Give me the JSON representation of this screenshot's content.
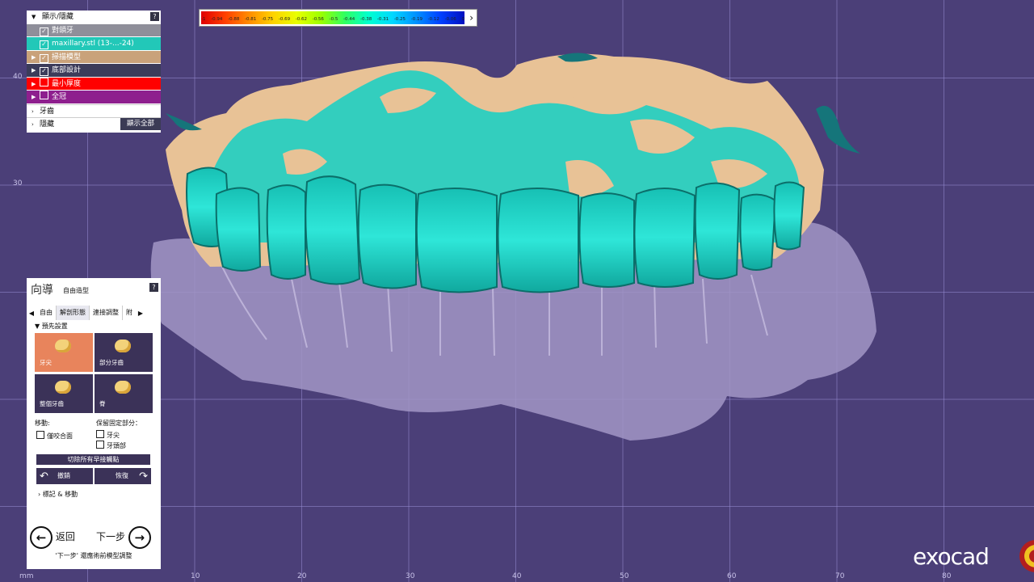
{
  "color_scale": {
    "ticks": [
      "-1",
      "-0.94",
      "-0.88",
      "-0.81",
      "-0.75",
      "-0.69",
      "-0.62",
      "-0.56",
      "-0.5",
      "-0.44",
      "-0.38",
      "-0.31",
      "-0.25",
      "-0.19",
      "-0.12",
      "-0.06",
      "0"
    ],
    "arrow": "›"
  },
  "display_panel": {
    "header": "顯示/隱藏",
    "help": "?",
    "rows": [
      {
        "label": "對頜牙",
        "checked": "✓",
        "color": "#8f8f9a"
      },
      {
        "label": "maxillary.stl (13-...-24)",
        "checked": "✓",
        "color": "#22c8b8"
      },
      {
        "label": "掃描模型",
        "checked": "✓",
        "color": "#c9a27a"
      },
      {
        "label": "底部設計",
        "checked": "✓",
        "color": "#3c3c5a"
      },
      {
        "label": "最小厚度",
        "checked": "",
        "color": "#ff0000"
      },
      {
        "label": "全冠",
        "checked": "",
        "color": "#8e1f8e"
      }
    ],
    "teeth_label": "牙齒",
    "hidden_label": "隱藏",
    "show_all": "顯示全部"
  },
  "wizard": {
    "title": "向導",
    "subtitle": "自由造型",
    "help": "?",
    "tabs": [
      "自由",
      "解剖形態",
      "連接調整",
      "附"
    ],
    "preset_header": "預先設置",
    "tools": [
      "牙尖",
      "部分牙齒",
      "整個牙齒",
      "脊"
    ],
    "move_label": "移動:",
    "keep_label": "保留固定部分：",
    "occlusal_only": "僅咬合面",
    "keep_cusp": "牙尖",
    "keep_crown": "牙頭部",
    "remove_contacts": "切除所有早接觸點",
    "undo": "撤銷",
    "redo": "恢復",
    "mark_move": "標記 & 移動",
    "back": "返回",
    "next": "下一步",
    "hint": "'下一步' 還應術前模型調整"
  },
  "ruler": {
    "unit": "mm",
    "x_ticks": [
      "10",
      "20",
      "30",
      "40",
      "50",
      "60",
      "70",
      "80"
    ],
    "y_ticks": [
      "40",
      "30"
    ]
  },
  "brand": "exocad",
  "colors": {
    "background": "#4b3f78",
    "teeth": "#22dcd0",
    "gum_scan": "#e8c296",
    "antagonist": "#a498c8",
    "tool_bg": "#3b3258",
    "tool_active": "#e8845c"
  }
}
